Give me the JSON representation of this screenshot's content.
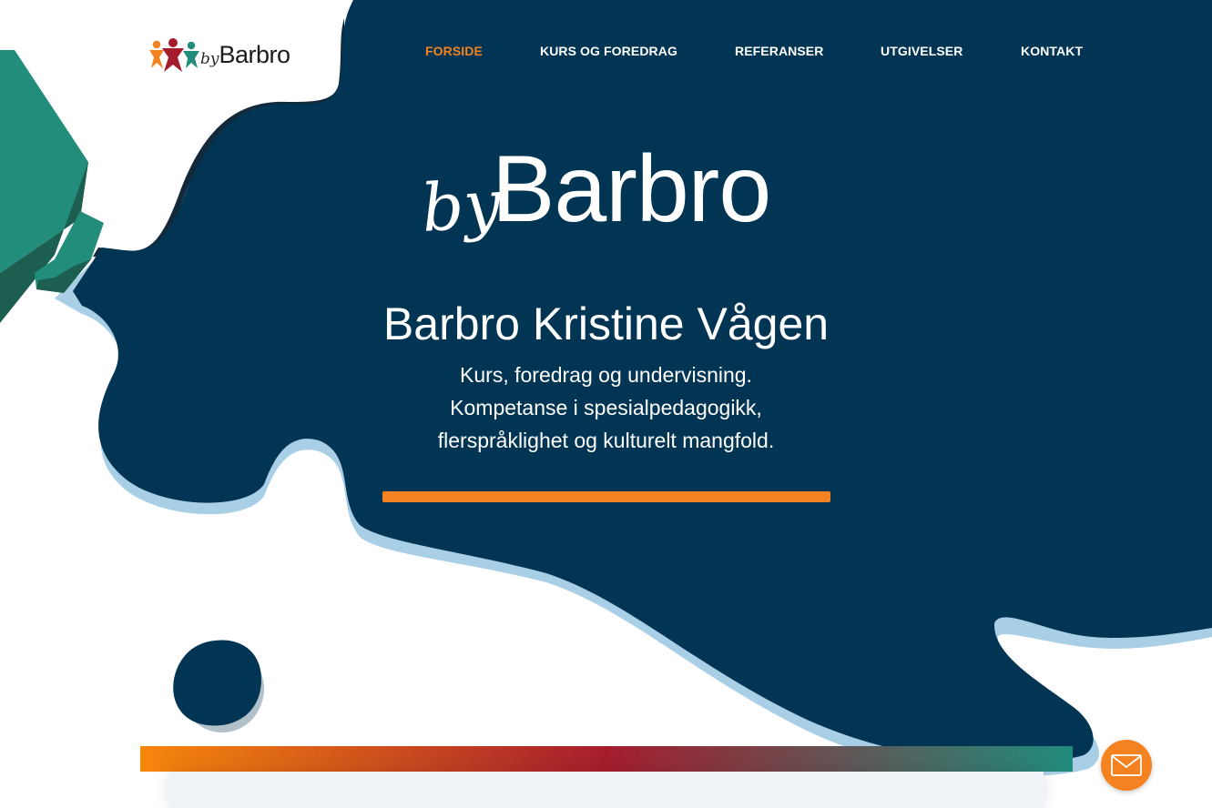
{
  "colors": {
    "navy": "#013553",
    "light_blue": "#a9cfe6",
    "teal": "#238d7b",
    "teal_dark": "#1c6e5f",
    "orange": "#f58220",
    "white": "#ffffff",
    "gradient": [
      "#f7860c",
      "#a51d2d",
      "#208c7d"
    ]
  },
  "logo": {
    "by": "by",
    "name": "Barbro"
  },
  "nav": {
    "items": [
      {
        "label": "FORSIDE",
        "active": true
      },
      {
        "label": "KURS OG FOREDRAG",
        "active": false
      },
      {
        "label": "REFERANSER",
        "active": false
      },
      {
        "label": "UTGIVELSER",
        "active": false
      },
      {
        "label": "KONTAKT",
        "active": false
      }
    ]
  },
  "hero": {
    "brand_by": "by",
    "brand_name": "Barbro",
    "title": "Barbro Kristine Vågen",
    "lines": [
      "Kurs, foredrag og undervisning.",
      "Kompetanse i spesialpedagogikk,",
      "flerspråklighet og kulturelt mangfold."
    ]
  },
  "contact_button": {
    "icon": "envelope-icon"
  }
}
